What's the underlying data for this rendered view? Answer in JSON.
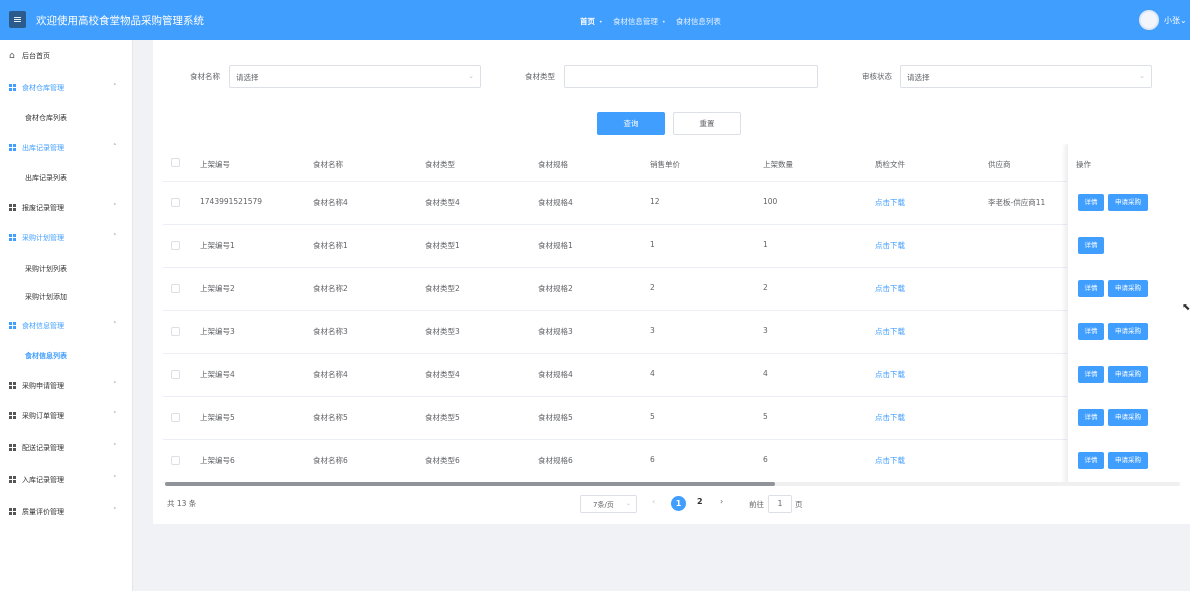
{
  "header": {
    "menu_icon": "hamburger-icon",
    "title": "欢迎使用高校食堂物品采购管理系统",
    "breadcrumbs": [
      "首页",
      "食材信息管理",
      "食材信息列表"
    ],
    "user": "小张"
  },
  "sidebar": {
    "home": "后台首页",
    "groups": [
      {
        "label": "食材仓库管理",
        "expanded": true,
        "children": [
          "食材仓库列表"
        ]
      },
      {
        "label": "出库记录管理",
        "expanded": true,
        "children": [
          "出库记录列表"
        ]
      },
      {
        "label": "报废记录管理",
        "expanded": false,
        "children": []
      },
      {
        "label": "采购计划管理",
        "expanded": true,
        "children": [
          "采购计划列表",
          "采购计划添加"
        ]
      },
      {
        "label": "食材信息管理",
        "expanded": true,
        "children": [
          "食材信息列表"
        ]
      },
      {
        "label": "采购申请管理",
        "expanded": false,
        "children": []
      },
      {
        "label": "采购订单管理",
        "expanded": false,
        "children": []
      },
      {
        "label": "配送记录管理",
        "expanded": false,
        "children": []
      },
      {
        "label": "入库记录管理",
        "expanded": false,
        "children": []
      },
      {
        "label": "质量评价管理",
        "expanded": false,
        "children": []
      }
    ],
    "active_item": "食材信息列表"
  },
  "filters": {
    "name_label": "食材名称",
    "name_value": "请选择",
    "type_label": "食材类型",
    "type_value": "",
    "status_label": "审核状态",
    "status_value": "请选择",
    "query_button": "查询",
    "reset_button": "重置"
  },
  "table": {
    "columns": [
      "上架编号",
      "食材名称",
      "食材类型",
      "食材规格",
      "销售单价",
      "上架数量",
      "质检文件",
      "供应商",
      "操作"
    ],
    "rows": [
      {
        "code": "1743991521579",
        "name": "食材名称4",
        "type": "食材类型4",
        "spec": "食材规格4",
        "price": "12",
        "qty": "100",
        "file": "点击下载",
        "supplier": "李老板-供应商11",
        "detail": "详情",
        "apply": "申请采购"
      },
      {
        "code": "上架编号1",
        "name": "食材名称1",
        "type": "食材类型1",
        "spec": "食材规格1",
        "price": "1",
        "qty": "1",
        "file": "点击下载",
        "supplier": "",
        "detail": "详情",
        "apply": ""
      },
      {
        "code": "上架编号2",
        "name": "食材名称2",
        "type": "食材类型2",
        "spec": "食材规格2",
        "price": "2",
        "qty": "2",
        "file": "点击下载",
        "supplier": "",
        "detail": "详情",
        "apply": "申请采购"
      },
      {
        "code": "上架编号3",
        "name": "食材名称3",
        "type": "食材类型3",
        "spec": "食材规格3",
        "price": "3",
        "qty": "3",
        "file": "点击下载",
        "supplier": "",
        "detail": "详情",
        "apply": "申请采购"
      },
      {
        "code": "上架编号4",
        "name": "食材名称4",
        "type": "食材类型4",
        "spec": "食材规格4",
        "price": "4",
        "qty": "4",
        "file": "点击下载",
        "supplier": "",
        "detail": "详情",
        "apply": "申请采购"
      },
      {
        "code": "上架编号5",
        "name": "食材名称5",
        "type": "食材类型5",
        "spec": "食材规格5",
        "price": "5",
        "qty": "5",
        "file": "点击下载",
        "supplier": "",
        "detail": "详情",
        "apply": "申请采购"
      },
      {
        "code": "上架编号6",
        "name": "食材名称6",
        "type": "食材类型6",
        "spec": "食材规格6",
        "price": "6",
        "qty": "6",
        "file": "点击下载",
        "supplier": "",
        "detail": "详情",
        "apply": "申请采购"
      }
    ]
  },
  "pagination": {
    "total": "共 13 条",
    "page_size": "7条/页",
    "pages": [
      "1",
      "2"
    ],
    "current": "1",
    "goto_label": "前往",
    "goto_value": "1",
    "page_suffix": "页"
  },
  "colors": {
    "primary": "#409eff",
    "background": "#f0f2f5"
  }
}
